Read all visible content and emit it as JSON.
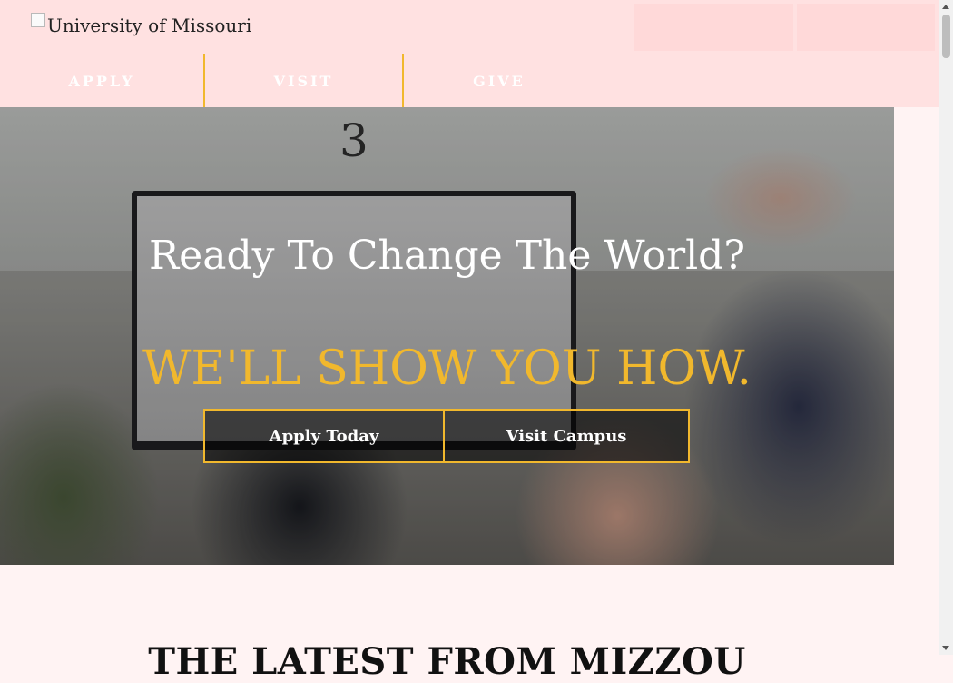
{
  "header": {
    "logo_alt": "University of Missouri",
    "nav": [
      {
        "label": "APPLY"
      },
      {
        "label": "VISIT"
      },
      {
        "label": "GIVE"
      }
    ]
  },
  "hero": {
    "title": "Ready To Change The World?",
    "subtitle": "WE'LL SHOW YOU HOW.",
    "room_number": "3",
    "buttons": [
      {
        "label": "Apply Today"
      },
      {
        "label": "Visit Campus"
      }
    ]
  },
  "section": {
    "heading": "THE LATEST FROM MIZZOU"
  },
  "colors": {
    "gold": "#f1b82d",
    "header_bg": "#ffe1e1",
    "page_bg": "#fff3f3"
  }
}
